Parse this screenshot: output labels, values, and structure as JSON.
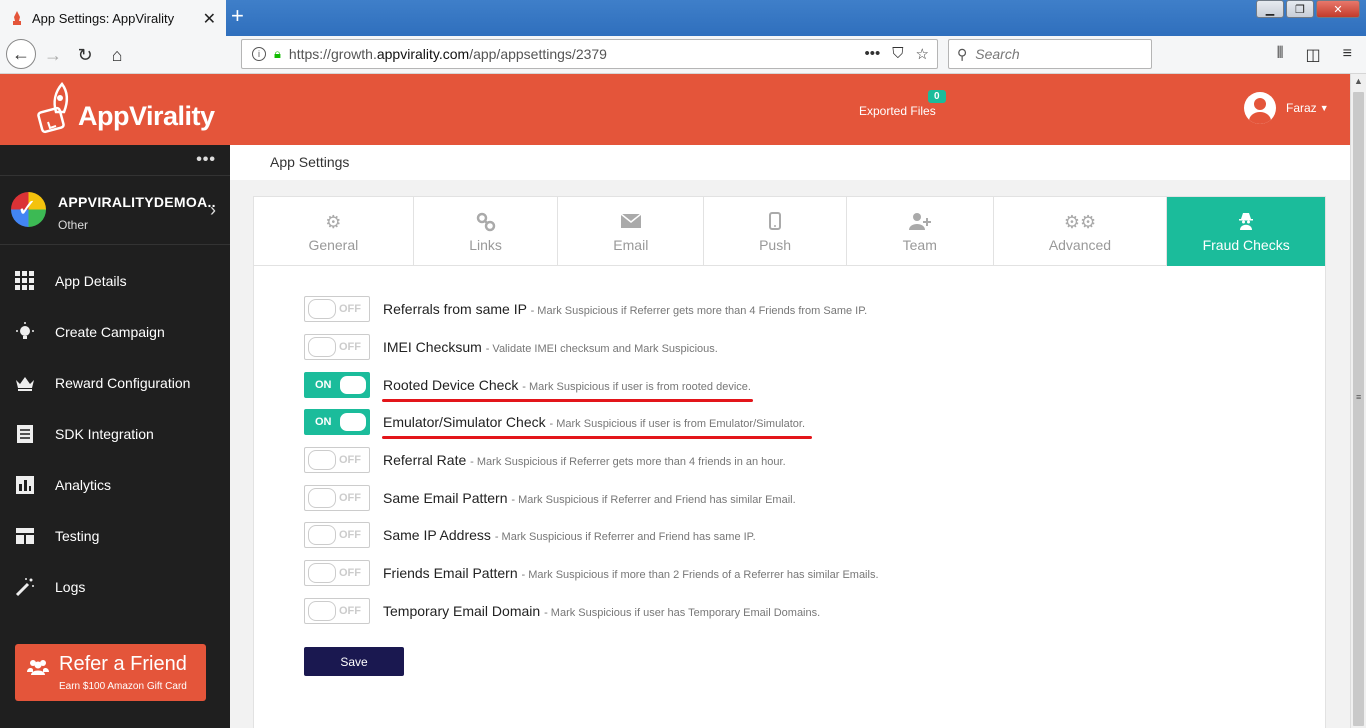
{
  "browser": {
    "tab_title": "App Settings: AppVirality",
    "url_prefix": "https://growth.",
    "url_domain": "appvirality.com",
    "url_path": "/app/appsettings/2379",
    "search_placeholder": "Search",
    "menu_dots": "•••"
  },
  "header": {
    "logo_text": "AppVirality",
    "exported_label": "Exported Files",
    "exported_count": "0",
    "user_name": "Faraz"
  },
  "sidebar": {
    "app_name": "APPVIRALITYDEMOA..",
    "app_category": "Other",
    "items": [
      {
        "label": "App Details",
        "icon": "grid-icon"
      },
      {
        "label": "Create Campaign",
        "icon": "bulb-icon"
      },
      {
        "label": "Reward Configuration",
        "icon": "crown-icon"
      },
      {
        "label": "SDK Integration",
        "icon": "receipt-icon"
      },
      {
        "label": "Analytics",
        "icon": "chart-icon"
      },
      {
        "label": "Testing",
        "icon": "layout-icon"
      },
      {
        "label": "Logs",
        "icon": "wand-icon"
      }
    ],
    "refer": {
      "title": "Refer a Friend",
      "subtitle": "Earn $100 Amazon Gift Card"
    }
  },
  "main": {
    "page_title": "App Settings",
    "tabs": [
      {
        "label": "General",
        "icon": "gear-icon"
      },
      {
        "label": "Links",
        "icon": "link-icon"
      },
      {
        "label": "Email",
        "icon": "envelope-icon"
      },
      {
        "label": "Push",
        "icon": "mobile-icon"
      },
      {
        "label": "Team",
        "icon": "user-plus-icon"
      },
      {
        "label": "Advanced",
        "icon": "gears-icon"
      },
      {
        "label": "Fraud Checks",
        "icon": "spy-icon",
        "active": true
      }
    ],
    "checks": [
      {
        "title": "Referrals from same IP",
        "desc": "- Mark Suspicious if Referrer gets more than 4 Friends from Same IP.",
        "state": "OFF"
      },
      {
        "title": "IMEI Checksum",
        "desc": "- Validate IMEI checksum and Mark Suspicious.",
        "state": "OFF"
      },
      {
        "title": "Rooted Device Check",
        "desc": "- Mark Suspicious if user is from rooted device.",
        "state": "ON"
      },
      {
        "title": "Emulator/Simulator Check",
        "desc": "- Mark Suspicious if user is from Emulator/Simulator.",
        "state": "ON"
      },
      {
        "title": "Referral Rate",
        "desc": "- Mark Suspicious if Referrer gets more than 4 friends in an hour.",
        "state": "OFF"
      },
      {
        "title": "Same Email Pattern",
        "desc": "- Mark Suspicious if Referrer and Friend has similar Email.",
        "state": "OFF"
      },
      {
        "title": "Same IP Address",
        "desc": "- Mark Suspicious if Referrer and Friend has same IP.",
        "state": "OFF"
      },
      {
        "title": "Friends Email Pattern",
        "desc": "- Mark Suspicious if more than 2 Friends of a Referrer has similar Emails.",
        "state": "OFF"
      },
      {
        "title": "Temporary Email Domain",
        "desc": "- Mark Suspicious if user has Temporary Email Domains.",
        "state": "OFF"
      }
    ],
    "save_label": "Save"
  },
  "colors": {
    "brand": "#e4553a",
    "accent": "#1bbc9b",
    "save": "#1a1850",
    "highlight": "#e3151a"
  }
}
